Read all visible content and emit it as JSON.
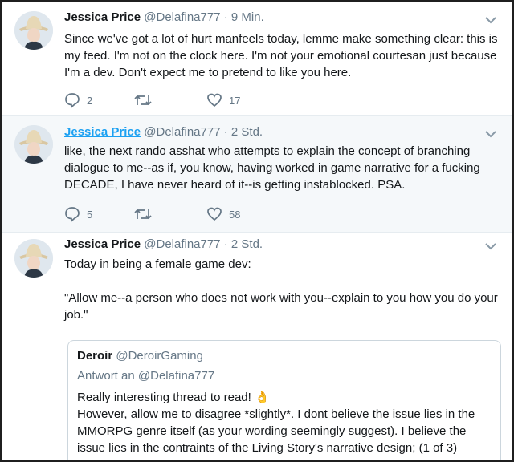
{
  "tweets": [
    {
      "name": "Jessica Price",
      "handle": "@Delafina777",
      "separator": "·",
      "time": "9 Min.",
      "text": "Since we've got a lot of hurt manfeels today, lemme make something clear: this is my feed. I'm not on the clock here. I'm not your emotional courtesan just because I'm a dev. Don't expect me to pretend to like you here.",
      "replies": "2",
      "retweets": "",
      "likes": "17"
    },
    {
      "name": "Jessica Price",
      "handle": "@Delafina777",
      "separator": "·",
      "time": "2 Std.",
      "text": "like, the next rando asshat who attempts to explain the concept of branching dialogue to me--as if, you know, having worked in game narrative for a fucking DECADE, I have never heard of it--is getting instablocked. PSA.",
      "replies": "5",
      "retweets": "",
      "likes": "58"
    },
    {
      "name": "Jessica Price",
      "handle": "@Delafina777",
      "separator": "·",
      "time": "2 Std.",
      "text_line1": "Today in being a female game dev:",
      "text_line2": "\"Allow me--a person who does not work with you--explain to you how you do your job.\""
    }
  ],
  "quote": {
    "name": "Deroir",
    "handle": "@DeroirGaming",
    "reply_prefix": "Antwort an",
    "reply_handle": "@Delafina777",
    "line1": "Really interesting thread to read!",
    "emoji": "👌",
    "line2": "However, allow me to disagree *slightly*. I dont believe the issue lies in the MMORPG genre itself (as your wording seemingly suggest). I believe the issue lies in the contraints of the Living Story's narrative design; (1 of 3)"
  },
  "colors": {
    "accent": "#1da1f2",
    "muted": "#657786",
    "hover_bg": "#f5f8fa"
  },
  "icons": [
    "avatar-cowboy-hat",
    "chevron-down-icon",
    "reply-icon",
    "retweet-icon",
    "heart-icon"
  ]
}
